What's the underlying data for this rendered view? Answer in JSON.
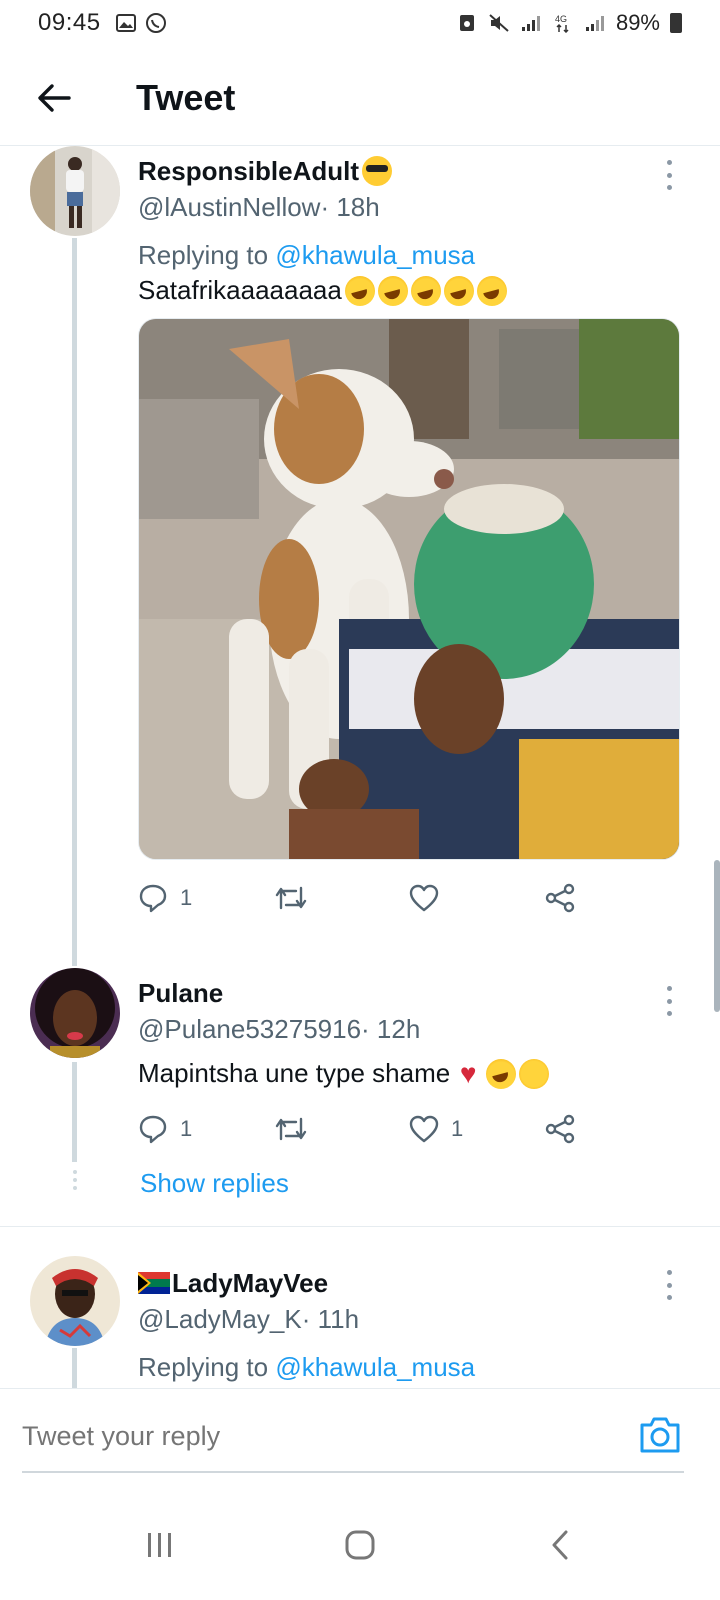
{
  "status_bar": {
    "time": "09:45",
    "battery": "89%",
    "left_icons": [
      "image-icon",
      "whatsapp-icon"
    ],
    "right_icons": [
      "nfc-icon",
      "mute-icon",
      "signal-icon",
      "4g-icon",
      "signal-icon-2"
    ]
  },
  "header": {
    "back_icon": "arrow-left-icon",
    "title": "Tweet"
  },
  "tweets": [
    {
      "display_name": "ResponsibleAdult",
      "name_emoji": "smiling-face-with-sunglasses",
      "handle": "@lAustinNellow",
      "time": " · 18h",
      "replying_label": "Replying to ",
      "replying_to": "@khawula_musa",
      "text": "Satafrikaaaaaaaa",
      "text_emojis": [
        "rolling-on-floor-laughing",
        "rolling-on-floor-laughing",
        "rolling-on-floor-laughing",
        "rolling-on-floor-laughing",
        "rolling-on-floor-laughing"
      ],
      "has_media": true,
      "actions": {
        "replies": "1",
        "retweets": "",
        "likes": ""
      }
    },
    {
      "display_name": "Pulane",
      "handle": "@Pulane53275916",
      "time": " · 12h",
      "text": "Mapintsha une type shame",
      "text_emojis": [
        "broken-heart",
        "rolling-on-floor-laughing",
        "face-with-hand-over-mouth"
      ],
      "actions": {
        "replies": "1",
        "retweets": "",
        "likes": "1"
      },
      "show_replies": "Show replies"
    },
    {
      "display_name": "LadyMayVee",
      "name_flag": "south-africa-flag",
      "handle": "@LadyMay_K",
      "time": " · 11h",
      "replying_label": "Replying to ",
      "replying_to": "@khawula_musa"
    }
  ],
  "composer": {
    "placeholder": "Tweet your reply",
    "camera_icon": "camera-icon"
  },
  "nav": {
    "recent_icon": "recent-apps-icon",
    "home_icon": "home-icon",
    "back_icon": "back-icon"
  },
  "colors": {
    "accent": "#1d9bf0",
    "secondary_text": "#536471",
    "thread_line": "#cfd9de"
  }
}
